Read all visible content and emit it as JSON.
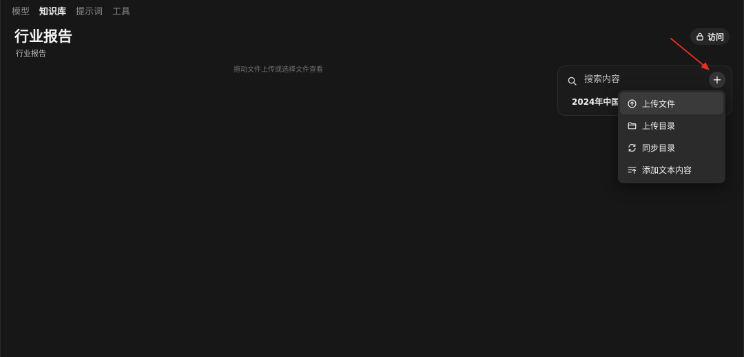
{
  "nav": {
    "tabs": [
      {
        "label": "模型",
        "active": false
      },
      {
        "label": "知识库",
        "active": true
      },
      {
        "label": "提示词",
        "active": false
      },
      {
        "label": "工具",
        "active": false
      }
    ]
  },
  "header": {
    "title": "行业报告",
    "subtitle": "行业报告",
    "access_label": "访问",
    "access_icon": "lock-icon"
  },
  "main": {
    "drop_hint": "拖动文件上传或选择文件查看"
  },
  "search": {
    "placeholder": "搜索内容",
    "icon": "search-icon",
    "add_label": "+",
    "results": [
      {
        "label": "2024年中国"
      }
    ]
  },
  "menu": {
    "items": [
      {
        "label": "上传文件",
        "icon": "upload-circle-icon"
      },
      {
        "label": "上传目录",
        "icon": "folder-icon"
      },
      {
        "label": "同步目录",
        "icon": "sync-icon"
      },
      {
        "label": "添加文本内容",
        "icon": "add-text-icon"
      }
    ]
  },
  "colors": {
    "background": "#171717",
    "panel": "#1b1b1b",
    "menu": "#2b2b2b",
    "annotation": "#e8331f"
  }
}
